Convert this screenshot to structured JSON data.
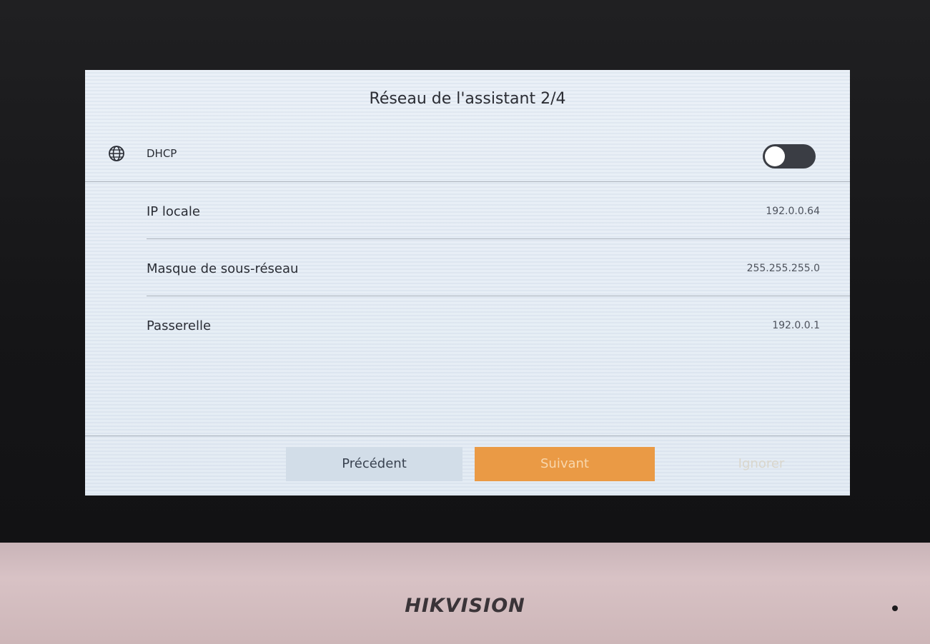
{
  "screen": {
    "title": "Réseau de l'assistant 2/4"
  },
  "dhcp": {
    "label": "DHCP",
    "icon": "globe-icon",
    "toggle_state": "off"
  },
  "fields": [
    {
      "label": "IP locale",
      "value": "192.0.0.64"
    },
    {
      "label": "Masque de sous-réseau",
      "value": "255.255.255.0"
    },
    {
      "label": "Passerelle",
      "value": "192.0.0.1"
    }
  ],
  "buttons": {
    "previous": "Précédent",
    "next": "Suivant",
    "skip": "Ignorer"
  },
  "device": {
    "brand": "HIKVISION"
  },
  "colors": {
    "accent": "#ea9a45",
    "secondary_button": "#d2dde8",
    "toggle_track": "#3a3d44"
  }
}
